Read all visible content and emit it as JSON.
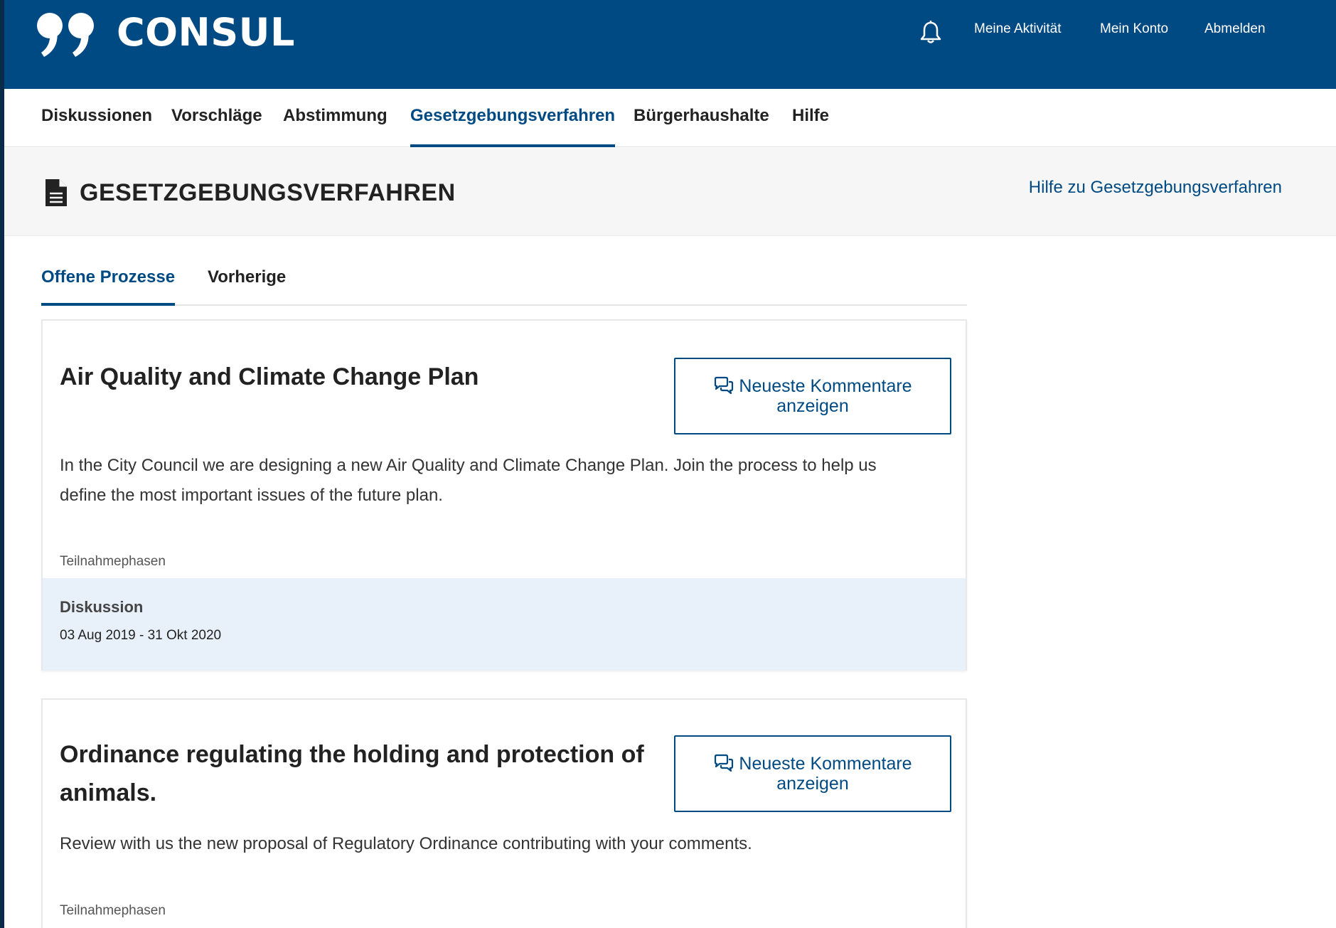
{
  "header": {
    "logo_text": "CONSUL",
    "links": [
      "Meine Aktivität",
      "Mein Konto",
      "Abmelden"
    ],
    "brand_color": "#004a83"
  },
  "nav": {
    "items": [
      "Diskussionen",
      "Vorschläge",
      "Abstimmung",
      "Gesetzgebungsverfahren",
      "Bürgerhaushalte",
      "Hilfe"
    ],
    "active": "Gesetzgebungsverfahren"
  },
  "section": {
    "title": "GESETZGEBUNGSVERFAHREN",
    "help_link": "Hilfe zu Gesetzgebungsverfahren"
  },
  "tabs": {
    "items": [
      "Offene Prozesse",
      "Vorherige"
    ],
    "active": "Offene Prozesse"
  },
  "processes": [
    {
      "title": "Air Quality and Climate Change Plan",
      "description": "In the City Council we are designing a new Air Quality and Climate Change Plan. Join the process to help us define the most important issues of the future plan.",
      "button_label_line1": "Neueste Kommentare",
      "button_label_line2": "anzeigen",
      "phases_label": "Teilnahmephasen",
      "phase": {
        "name": "Diskussion",
        "dates": "03 Aug 2019 - 31 Okt 2020"
      }
    },
    {
      "title": "Ordinance regulating the holding and protection of animals.",
      "description": "Review with us the new proposal of Regulatory Ordinance contributing with your comments.",
      "button_label_line1": "Neueste Kommentare",
      "button_label_line2": "anzeigen",
      "phases_label": "Teilnahmephasen"
    }
  ]
}
